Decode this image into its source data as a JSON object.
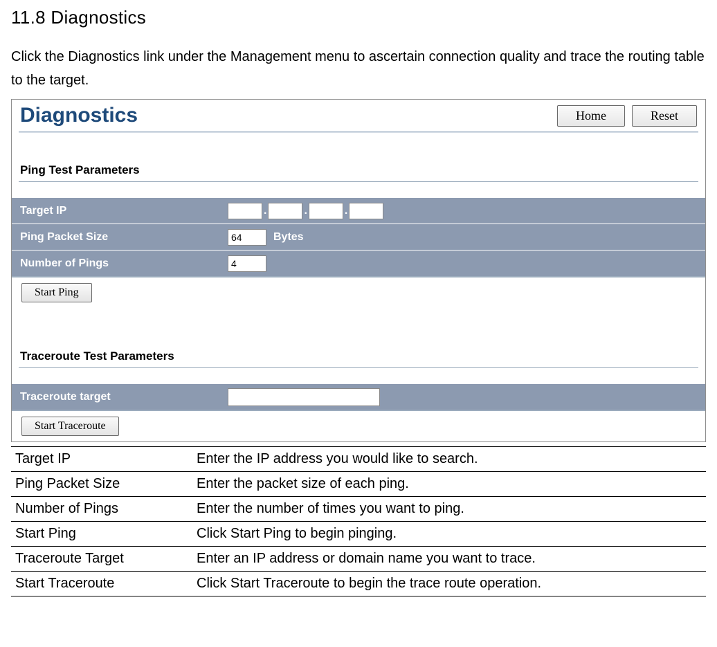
{
  "heading": "11.8 Diagnostics",
  "intro": "Click the Diagnostics link under the Management menu to ascertain connection quality and trace the routing table to the target.",
  "panel": {
    "title": "Diagnostics",
    "home_btn": "Home",
    "reset_btn": "Reset",
    "ping_section_label": "Ping Test Parameters",
    "ping_rows": {
      "target_ip_label": "Target IP",
      "packet_size_label": "Ping Packet Size",
      "packet_size_value": "64",
      "packet_size_unit": "Bytes",
      "num_pings_label": "Number of Pings",
      "num_pings_value": "4"
    },
    "start_ping_btn": "Start Ping",
    "traceroute_section_label": "Traceroute Test Parameters",
    "traceroute_rows": {
      "target_label": "Traceroute target",
      "target_value": ""
    },
    "start_traceroute_btn": "Start Traceroute"
  },
  "descriptions": [
    {
      "term": "Target IP",
      "desc": "Enter the IP address you would like to search."
    },
    {
      "term": "Ping Packet Size",
      "desc": "Enter the packet size of each ping."
    },
    {
      "term": "Number  of Pings",
      "desc": "Enter the number of times you want to ping."
    },
    {
      "term": "Start Ping",
      "desc": "Click Start Ping to begin pinging."
    },
    {
      "term": "Traceroute Target",
      "desc": "Enter an IP address or domain name you want to trace."
    },
    {
      "term": "Start Traceroute",
      "desc": "Click Start Traceroute to begin the trace route operation."
    }
  ]
}
